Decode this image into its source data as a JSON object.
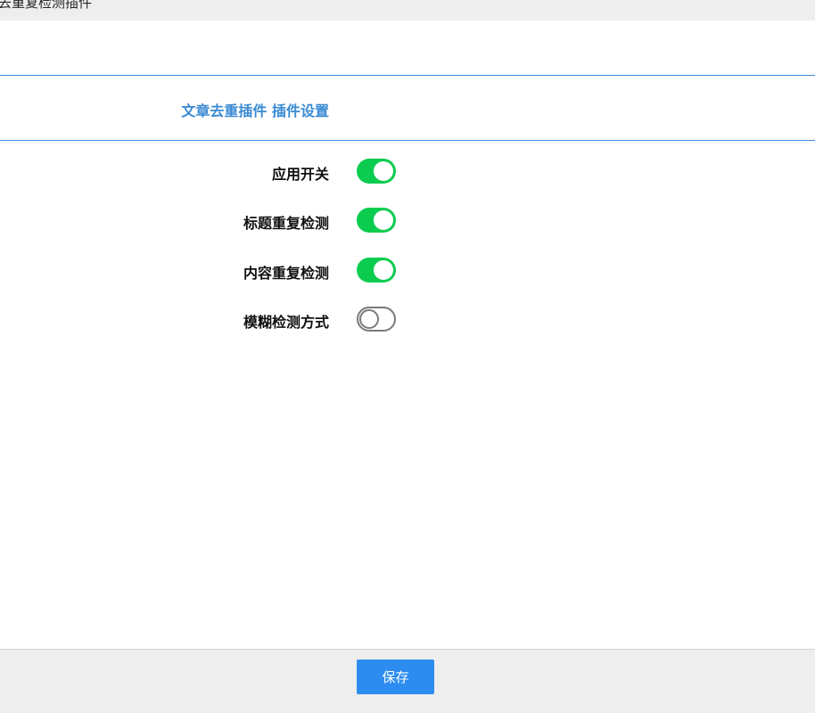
{
  "window": {
    "title": "去重复检测插件"
  },
  "header": {
    "heading": "文章去重插件 插件设置",
    "accent_color": "#3a8ad4"
  },
  "settings": [
    {
      "label": "应用开关",
      "enabled": true
    },
    {
      "label": "标题重复检测",
      "enabled": true
    },
    {
      "label": "内容重复检测",
      "enabled": true
    },
    {
      "label": "模糊检测方式",
      "enabled": false
    }
  ],
  "toggle_colors": {
    "on": "#0ccc50",
    "off_border": "#7a7a7a"
  },
  "footer": {
    "save_label": "保存",
    "save_color": "#2d8cf0"
  }
}
